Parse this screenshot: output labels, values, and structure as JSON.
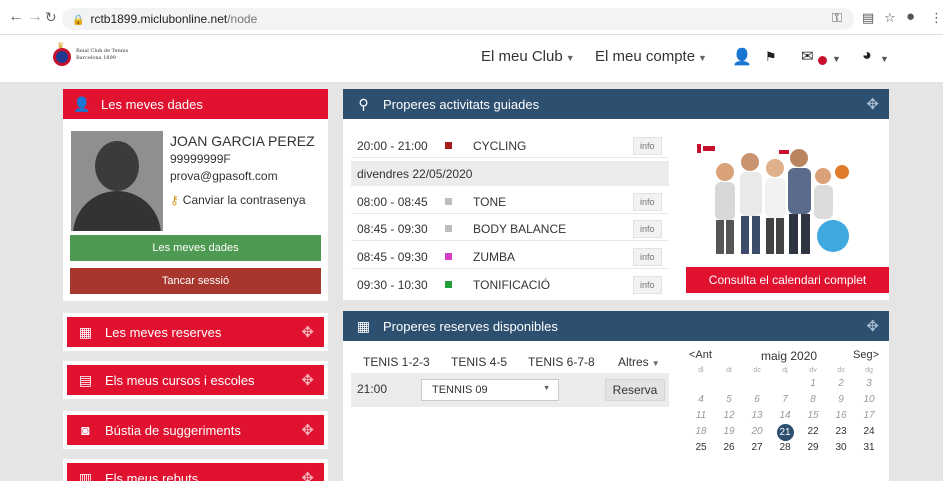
{
  "browser": {
    "domain": "rctb1899.miclubonline.net",
    "path": "/node"
  },
  "header": {
    "logo_line1": "Reial Club de Tennis",
    "logo_line2": "Barcelona 1899",
    "menu_club": "El meu Club",
    "menu_account": "El meu compte"
  },
  "profile": {
    "title": "Les meves dades",
    "name": "JOAN GARCIA PEREZ",
    "id": "99999999F",
    "email": "prova@gpasoft.com",
    "change_password": "Canviar la contrasenya",
    "my_data_button": "Les meves dades",
    "logout_button": "Tancar sessió"
  },
  "sidebar": {
    "items": [
      {
        "label": "Les meves reserves"
      },
      {
        "label": "Els meus cursos i escoles"
      },
      {
        "label": "Bústia de suggeriments"
      },
      {
        "label": "Els meus rebuts"
      }
    ]
  },
  "activities": {
    "title": "Properes activitats guiades",
    "info_label": "info",
    "first": {
      "time": "20:00 - 21:00",
      "name": "CYCLING",
      "color": "#a51c1c"
    },
    "day": "divendres 22/05/2020",
    "rows": [
      {
        "time": "08:00 - 08:45",
        "name": "TONE",
        "color": "#bdbdbd"
      },
      {
        "time": "08:45 - 09:30",
        "name": "BODY BALANCE",
        "color": "#bdbdbd"
      },
      {
        "time": "08:45 - 09:30",
        "name": "ZUMBA",
        "color": "#d63fc8"
      },
      {
        "time": "09:30 - 10:30",
        "name": "TONIFICACIÓ",
        "color": "#1f9e3a"
      }
    ],
    "calendar_button": "Consulta el calendari complet"
  },
  "reservations": {
    "title": "Properes reserves disponibles",
    "tabs": [
      "TENIS 1-2-3",
      "TENIS 4-5",
      "TENIS 6-7-8"
    ],
    "more_tab": "Altres",
    "slot_time": "21:00",
    "court": "TENNIS 09",
    "reserve_button": "Reserva"
  },
  "calendar": {
    "prev": "<Ant",
    "month": "maig 2020",
    "next": "Seg>",
    "weekdays": [
      "dl",
      "dt",
      "dc",
      "dj",
      "dv",
      "ds",
      "dg"
    ],
    "week1": [
      "",
      "",
      "",
      "",
      "1",
      "2",
      "3"
    ],
    "week2": [
      "4",
      "5",
      "6",
      "7",
      "8",
      "9",
      "10"
    ],
    "week3": [
      "11",
      "12",
      "13",
      "14",
      "15",
      "16",
      "17"
    ],
    "week4": [
      "18",
      "19",
      "20",
      "21",
      "22",
      "23",
      "24"
    ],
    "week5": [
      "25",
      "26",
      "27",
      "28",
      "29",
      "30",
      "31"
    ],
    "today": "21"
  },
  "colors": {
    "red": "#e0122f",
    "navy": "#2d4f70",
    "green": "#4e9a52",
    "brown": "#a8362d"
  }
}
